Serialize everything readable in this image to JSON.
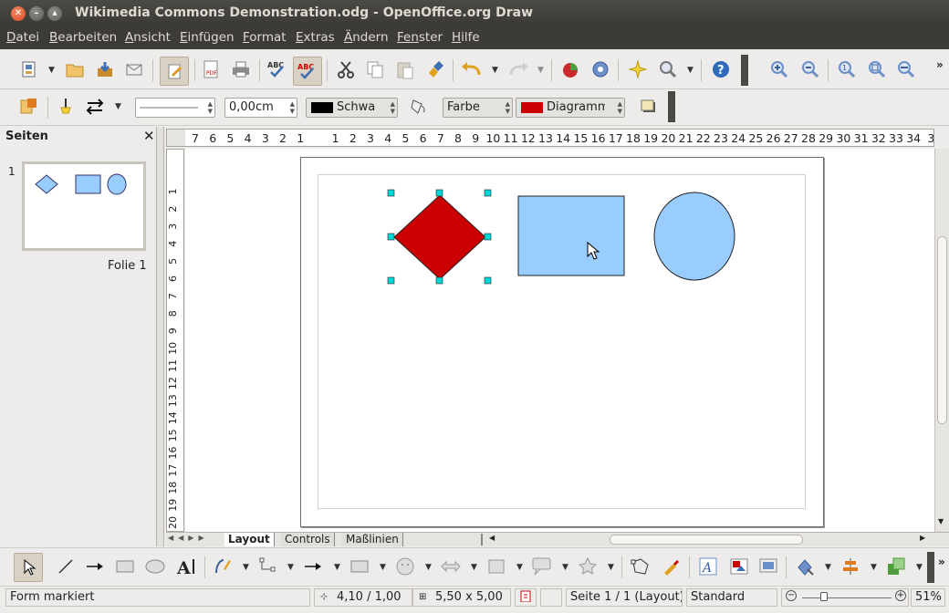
{
  "window": {
    "title": "Wikimedia Commons Demonstration.odg - OpenOffice.org Draw"
  },
  "menu": [
    {
      "first": "D",
      "rest": "atei"
    },
    {
      "first": "B",
      "rest": "earbeiten"
    },
    {
      "first": "A",
      "rest": "nsicht"
    },
    {
      "first": "E",
      "rest": "infügen"
    },
    {
      "first": "F",
      "rest": "ormat"
    },
    {
      "first": "E",
      "rest": "xtras"
    },
    {
      "first": "Ä",
      "rest": "ndern"
    },
    {
      "first": "Fen",
      "rest": "ster"
    },
    {
      "first": "H",
      "rest": "ilfe"
    }
  ],
  "line_toolbar": {
    "line_width": "0,00cm",
    "line_color": "Schwa",
    "line_color_hex": "#000000",
    "area_style": "Farbe",
    "area_color": "Diagramm",
    "area_color_hex": "#cc0000"
  },
  "sidebar": {
    "title": "Seiten",
    "close": "✕",
    "slide_number": "1",
    "slide_name": "Folie 1"
  },
  "ruler_h": [
    "7",
    "6",
    "5",
    "4",
    "3",
    "2",
    "1",
    "",
    "1",
    "2",
    "3",
    "4",
    "5",
    "6",
    "7",
    "8",
    "9",
    "10",
    "11",
    "12",
    "13",
    "14",
    "15",
    "16",
    "17",
    "18",
    "19",
    "20",
    "21",
    "22",
    "23",
    "24",
    "25",
    "26",
    "27",
    "28",
    "29",
    "30",
    "31",
    "32",
    "33",
    "34",
    "3"
  ],
  "ruler_v": [
    "1",
    "2",
    "3",
    "4",
    "5",
    "6",
    "7",
    "8",
    "9",
    "10",
    "11",
    "12",
    "13",
    "14",
    "15",
    "16",
    "17",
    "18",
    "19",
    "20"
  ],
  "shapes": {
    "diamond_color": "#cc0000",
    "rectangle_color": "#99ccff",
    "ellipse_color": "#99ccff",
    "selection_handle_color": "#00d8d8"
  },
  "tabs": [
    "Layout",
    "Controls",
    "Maßlinien"
  ],
  "status": {
    "mode": "Form markiert",
    "position": "4,10 / 1,00",
    "size": "5,50 x 5,00",
    "page": "Seite 1 / 1 (Layout)",
    "style": "Standard",
    "zoom": "51%"
  }
}
